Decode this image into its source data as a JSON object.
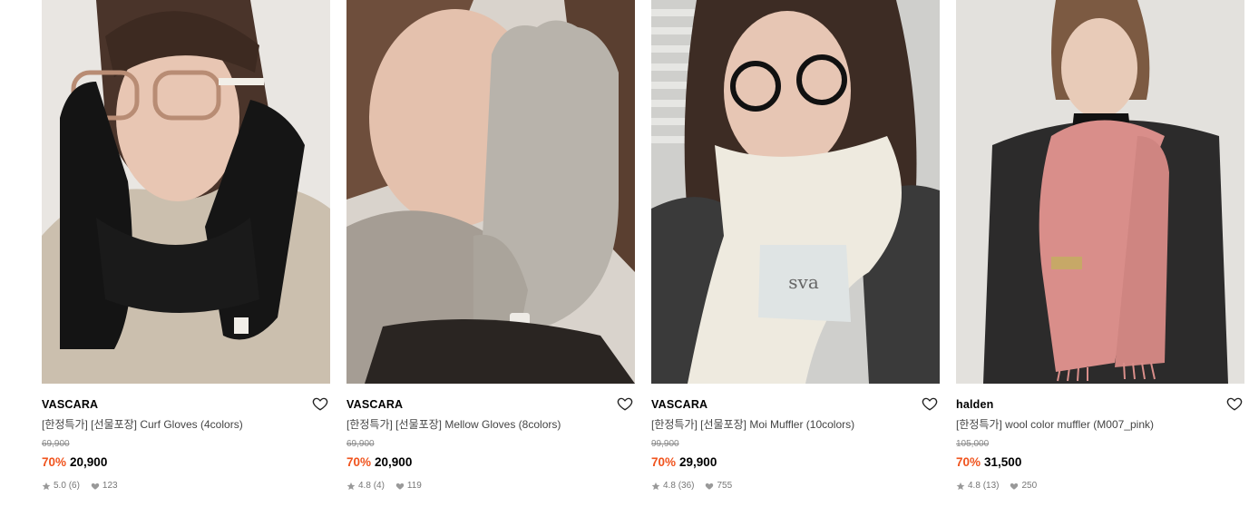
{
  "products": [
    {
      "brand": "VASCARA",
      "name": "[한정특가] [선물포장] Curf Gloves (4colors)",
      "original_price": "69,900",
      "discount": "70%",
      "sale_price": "20,900",
      "rating": "5.0",
      "reviews": "(6)",
      "likes": "123",
      "image_desc": "model-black-gloves-glasses"
    },
    {
      "brand": "VASCARA",
      "name": "[한정특가] [선물포장] Mellow Gloves (8colors)",
      "original_price": "69,900",
      "discount": "70%",
      "sale_price": "20,900",
      "rating": "4.8",
      "reviews": "(4)",
      "likes": "119",
      "image_desc": "model-grey-gloves"
    },
    {
      "brand": "VASCARA",
      "name": "[한정특가] [선물포장] Moi Muffler (10colors)",
      "original_price": "99,900",
      "discount": "70%",
      "sale_price": "29,900",
      "rating": "4.8",
      "reviews": "(36)",
      "likes": "755",
      "image_desc": "model-cream-muffler-glasses"
    },
    {
      "brand": "halden",
      "name": "[한정특가] wool color muffler (M007_pink)",
      "original_price": "105,000",
      "discount": "70%",
      "sale_price": "31,500",
      "rating": "4.8",
      "reviews": "(13)",
      "likes": "250",
      "image_desc": "model-pink-muffler"
    }
  ],
  "colors": {
    "discount": "#f0541e",
    "meta_text": "#777777",
    "name_text": "#444444"
  },
  "icons": {
    "wishlist": "heart-outline-icon",
    "rating": "star-icon",
    "likes": "heart-filled-icon"
  }
}
